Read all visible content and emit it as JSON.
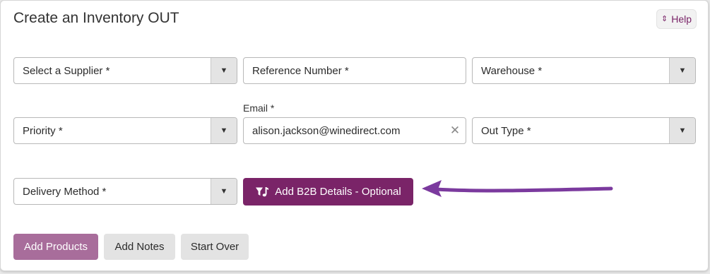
{
  "page": {
    "title": "Create an Inventory OUT",
    "help_label": "Help",
    "help_icon": "chevron-up-down-icon"
  },
  "form": {
    "supplier": {
      "placeholder": "Select a Supplier *"
    },
    "reference": {
      "placeholder": "Reference Number *"
    },
    "warehouse": {
      "placeholder": "Warehouse *"
    },
    "priority": {
      "placeholder": "Priority *"
    },
    "email": {
      "label": "Email *",
      "value": "alison.jackson@winedirect.com"
    },
    "out_type": {
      "placeholder": "Out Type *"
    },
    "delivery_method": {
      "placeholder": "Delivery Method *"
    }
  },
  "b2b_button": {
    "label": "Add B2B Details - Optional",
    "icon": "funnel-music-icon"
  },
  "actions": {
    "add_products": "Add Products",
    "add_notes": "Add Notes",
    "start_over": "Start Over"
  },
  "colors": {
    "brand": "#7a2468",
    "primary_disabled": "#a86d9b",
    "annotation_arrow": "#7b3a9e"
  }
}
